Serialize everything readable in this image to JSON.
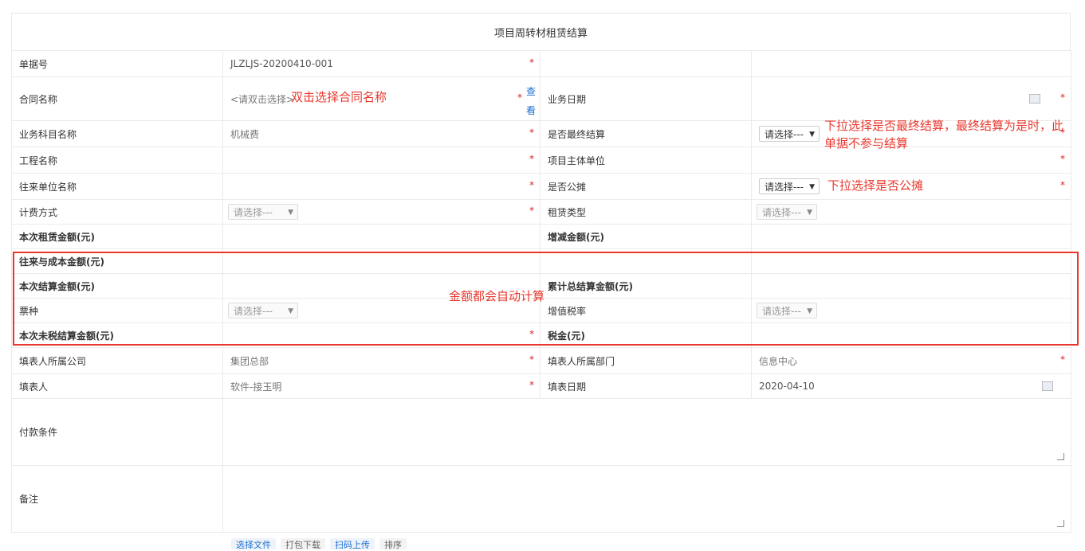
{
  "title": "项目周转材租赁结算",
  "required_mark": "*",
  "rows": {
    "doc_no": {
      "label": "单据号",
      "value": "JLZLJS-20200410-001"
    },
    "contract": {
      "label": "合同名称",
      "placeholder": "<请双击选择>",
      "view": "查看",
      "label2": "业务日期"
    },
    "subject": {
      "label": "业务科目名称",
      "value": "机械费",
      "label2": "是否最终结算",
      "select2": "请选择---"
    },
    "project": {
      "label": "工程名称",
      "label2": "项目主体单位"
    },
    "partner": {
      "label": "往来单位名称",
      "label2": "是否公摊",
      "select2": "请选择---"
    },
    "billing": {
      "label": "计费方式",
      "select": "请选择---",
      "label2": "租赁类型",
      "select2": "请选择---"
    },
    "rent_amount": {
      "label": "本次租赁金额(元)",
      "label2": "增减金额(元)"
    },
    "cost_amount": {
      "label": "往来与成本金额(元)"
    },
    "settle_amount": {
      "label": "本次结算金额(元)",
      "label2": "累计总结算金额(元)"
    },
    "ticket": {
      "label": "票种",
      "select": "请选择---",
      "label2": "增值税率",
      "select2": "请选择---"
    },
    "untaxed": {
      "label": "本次未税结算金额(元)",
      "label2": "税金(元)"
    },
    "company": {
      "label": "填表人所属公司",
      "value": "集团总部",
      "label2": "填表人所属部门",
      "value2": "信息中心"
    },
    "filler": {
      "label": "填表人",
      "value": "软件-接玉明",
      "label2": "填表日期",
      "value2": "2020-04-10"
    },
    "payment": {
      "label": "付款条件"
    },
    "remark": {
      "label": "备注"
    }
  },
  "annotations": {
    "contract": "双击选择合同名称",
    "final_1": "下拉选择是否最终结算，最终结算为是时，此",
    "final_2": "单据不参与结算",
    "share": "下拉选择是否公摊",
    "auto": "金额都会自动计算"
  },
  "bottom_buttons": [
    "选择文件",
    "打包下载",
    "扫码上传",
    "排序"
  ],
  "colors": {
    "required": "#e02020",
    "annotation": "#e8382e",
    "link": "#1e6fd0",
    "border": "#ebebeb"
  }
}
